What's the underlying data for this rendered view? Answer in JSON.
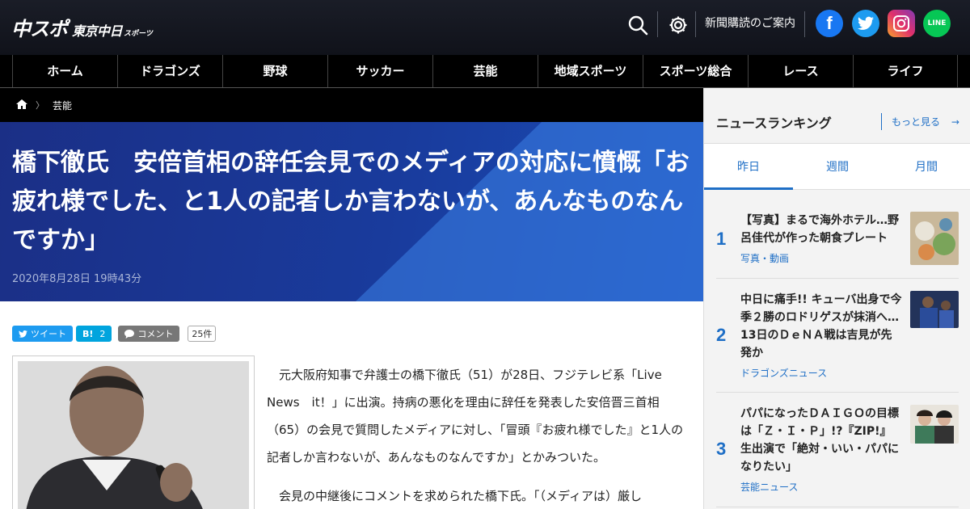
{
  "header": {
    "logo_main": "中スポ",
    "logo_sub": "東京中日",
    "logo_tiny": "スポーツ",
    "subscribe_label": "新聞購読のご案内",
    "social": {
      "facebook_letter": "f",
      "line_label": "LINE"
    }
  },
  "nav": {
    "items": [
      "ホーム",
      "ドラゴンズ",
      "野球",
      "サッカー",
      "芸能",
      "地域スポーツ",
      "スポーツ総合",
      "レース",
      "ライフ"
    ]
  },
  "breadcrumb": {
    "current": "芸能"
  },
  "article": {
    "title": "橋下徹氏　安倍首相の辞任会見でのメディアの対応に憤慨「お疲れ様でした、と1人の記者しか言わないが、あんなものなんですか」",
    "date": "2020年8月28日 19時43分",
    "share": {
      "tweet_label": "ツイート",
      "hatena_label": "B!",
      "hatena_count": "2",
      "comment_label": "コメント",
      "comment_count": "25件"
    },
    "paragraphs": [
      "元大阪府知事で弁護士の橋下徹氏（51）が28日、フジテレビ系「Live　News　it！」に出演。持病の悪化を理由に辞任を発表した安倍晋三首相（65）の会見で質問したメディアに対し、「冒頭『お疲れ様でした』と1人の記者しか言わないが、あんなものなんですか」とかみついた。",
      "会見の中継後にコメントを求められた橋下氏。「（メディアは）厳し"
    ]
  },
  "sidebar": {
    "title": "ニュースランキング",
    "more_label": "もっと見る",
    "tabs": [
      "昨日",
      "週間",
      "月間"
    ],
    "items": [
      {
        "rank": "1",
        "title": "【写真】まるで海外ホテル…野呂佳代が作った朝食プレート",
        "category": "写真・動画"
      },
      {
        "rank": "2",
        "title": "中日に痛手!! キューバ出身で今季２勝のロドリゲスが抹消へ…13日のＤｅＮＡ戦は吉見が先発か",
        "category": "ドラゴンズニュース"
      },
      {
        "rank": "3",
        "title": "パパになったＤＡＩＧＯの目標は「Ｚ・Ｉ・Ｐ」!?『ZIP!』生出演で「絶対・いい・パパになりたい」",
        "category": "芸能ニュース"
      }
    ]
  },
  "colors": {
    "accent": "#1f6fc6",
    "header_bg": "#10121a",
    "hero_bg": "#1b2f86"
  }
}
